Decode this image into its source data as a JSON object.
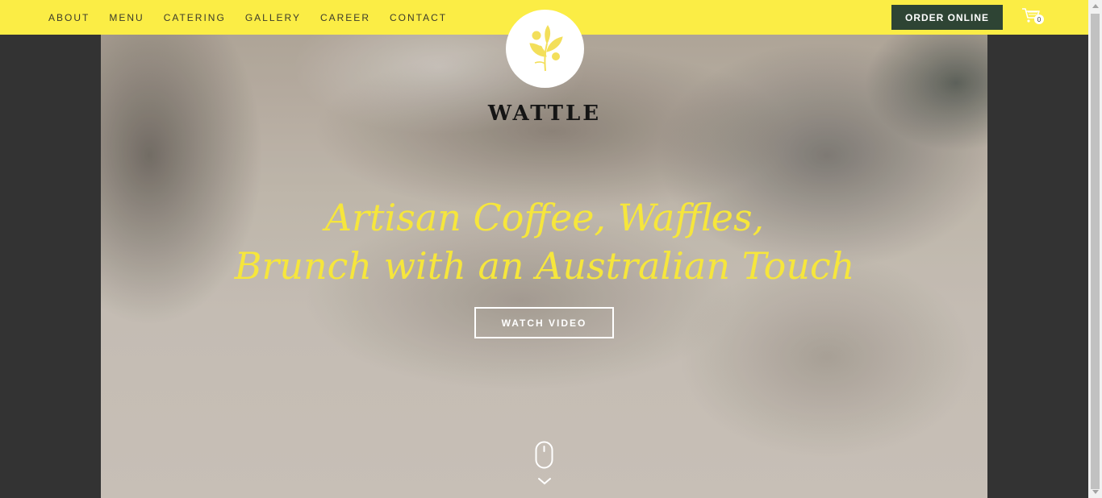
{
  "nav": {
    "items": [
      {
        "label": "ABOUT"
      },
      {
        "label": "MENU"
      },
      {
        "label": "CATERING"
      },
      {
        "label": "GALLERY"
      },
      {
        "label": "CAREER"
      },
      {
        "label": "CONTACT"
      }
    ],
    "order_label": "ORDER ONLINE",
    "cart_count": "0",
    "cart_icon": "shopping-cart-icon"
  },
  "brand": {
    "logo_icon": "wattle-flower-icon",
    "name": "WATTLE"
  },
  "hero": {
    "headline_line1": "Artisan Coffee, Waffles,",
    "headline_line2": "Brunch with an Australian Touch",
    "watch_label": "WATCH VIDEO",
    "scroll_icon": "mouse-scroll-icon",
    "chevron_icon": "chevron-down-icon"
  },
  "colors": {
    "nav_bg": "#fbed45",
    "order_bg": "#2e4434",
    "headline": "#f6e63c",
    "page_bg": "#333333"
  }
}
